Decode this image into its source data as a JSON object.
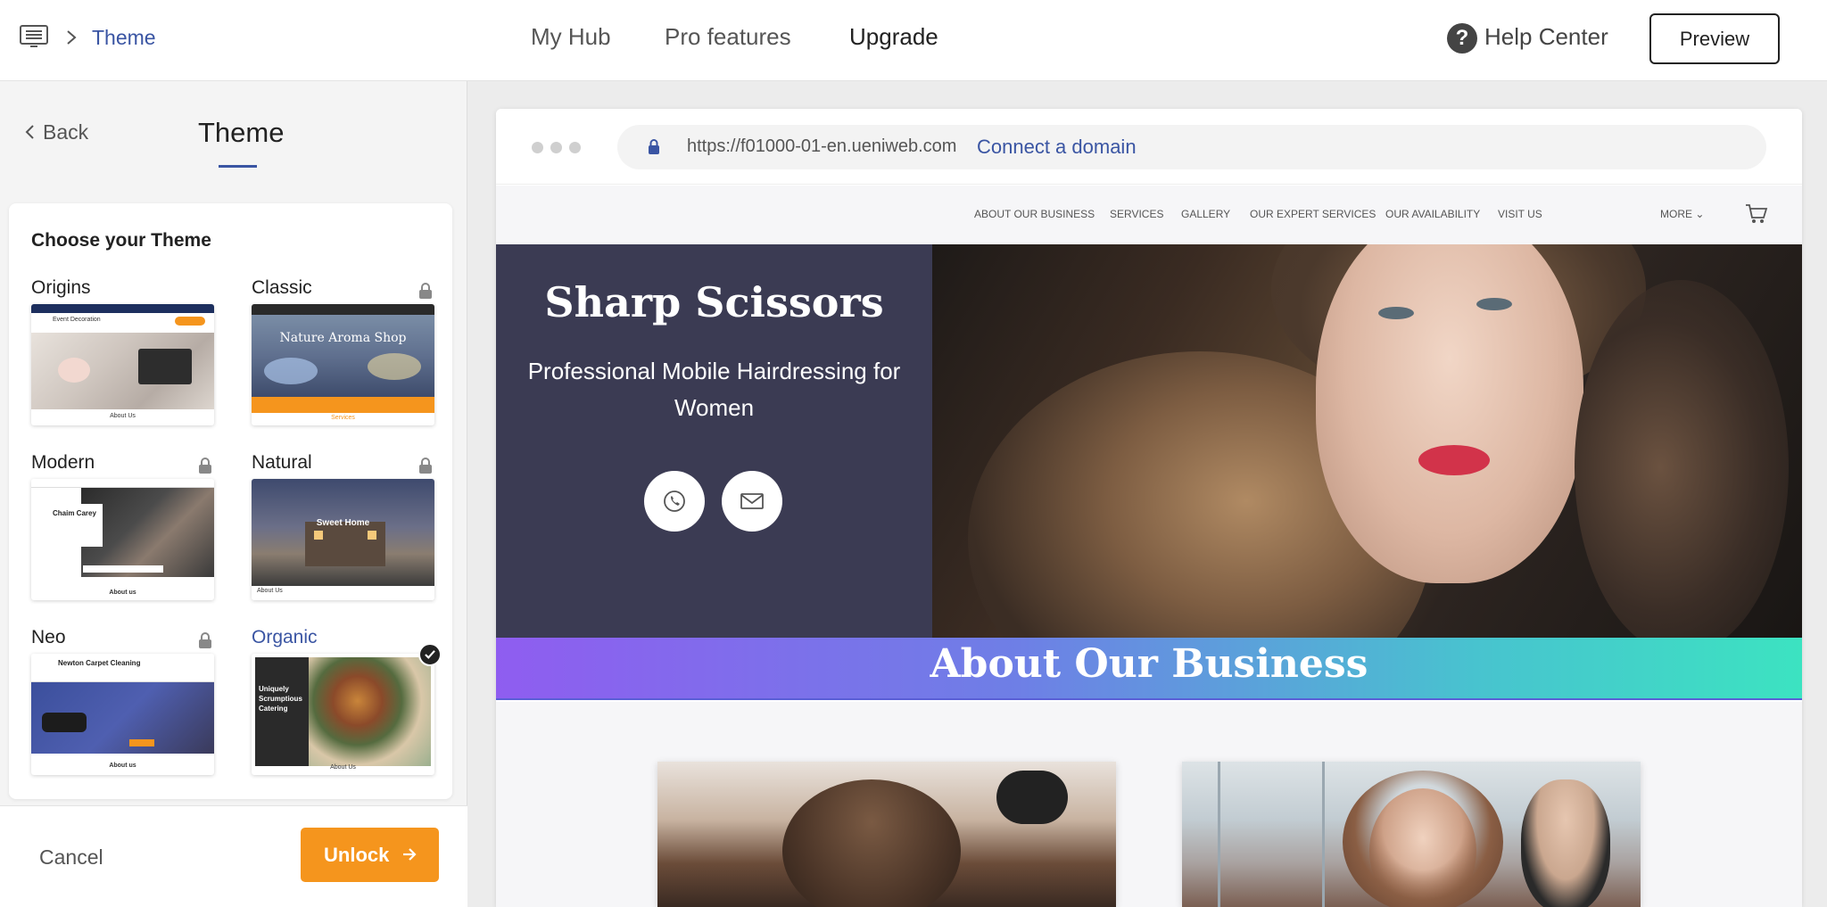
{
  "topbar": {
    "breadcrumb": "Theme",
    "nav": [
      {
        "label": "My Hub",
        "active": false
      },
      {
        "label": "Pro features",
        "active": false
      },
      {
        "label": "Upgrade",
        "active": true
      }
    ],
    "help_label": "Help Center",
    "preview_label": "Preview"
  },
  "left_panel": {
    "back_label": "Back",
    "title": "Theme",
    "card_title": "Choose your Theme",
    "themes": [
      {
        "name": "Origins",
        "locked": false,
        "selected": false,
        "thumb_caption": "About Us",
        "thumb_heading": "Event Decoration"
      },
      {
        "name": "Classic",
        "locked": true,
        "selected": false,
        "thumb_caption": "Services",
        "thumb_heading": "Nature Aroma Shop"
      },
      {
        "name": "Modern",
        "locked": true,
        "selected": false,
        "thumb_caption": "About us",
        "thumb_heading": "Chaim Carey"
      },
      {
        "name": "Natural",
        "locked": true,
        "selected": false,
        "thumb_caption": "About Us",
        "thumb_heading": "Sweet Home"
      },
      {
        "name": "Neo",
        "locked": true,
        "selected": false,
        "thumb_caption": "About us",
        "thumb_heading": "Newton Carpet Cleaning"
      },
      {
        "name": "Organic",
        "locked": false,
        "selected": true,
        "thumb_caption": "About Us",
        "thumb_heading": "Uniquely Scrumptious Catering"
      }
    ],
    "cancel_label": "Cancel",
    "unlock_label": "Unlock"
  },
  "preview": {
    "url": "https://f01000-01-en.ueniweb.com",
    "connect_label": "Connect a domain",
    "site_nav": [
      "ABOUT OUR BUSINESS",
      "SERVICES",
      "GALLERY",
      "OUR EXPERT SERVICES",
      "OUR AVAILABILITY",
      "VISIT US"
    ],
    "more_label": "MORE",
    "hero_title": "Sharp Scissors",
    "hero_subtitle": "Professional Mobile Hairdressing for Women",
    "section_title": "About Our Business"
  },
  "colors": {
    "accent": "#3a55a3",
    "unlock": "#f5951d",
    "hero_panel": "#3b3b53"
  }
}
